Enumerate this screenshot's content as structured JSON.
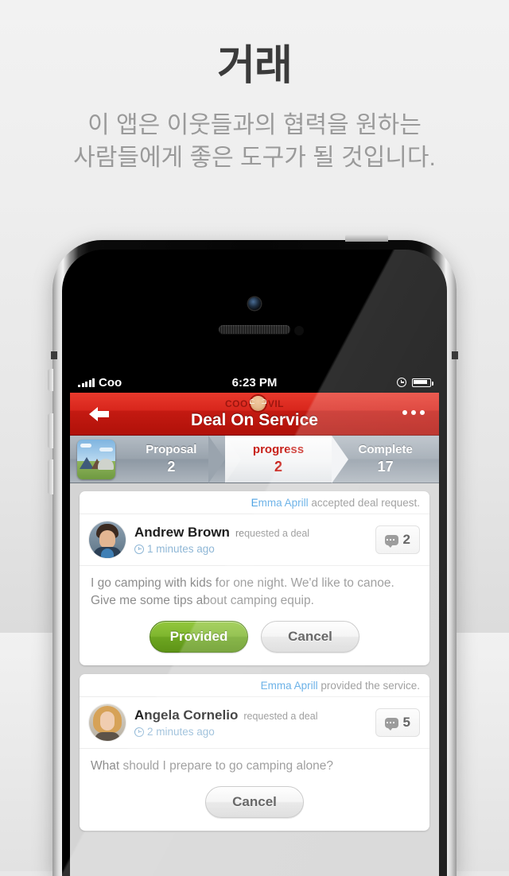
{
  "page": {
    "headline": "거래",
    "subtitle_line1": "이 앱은 이웃들과의 협력을 원하는",
    "subtitle_line2": "사람들에게 좋은 도구가 될 것입니다."
  },
  "status_bar": {
    "carrier": "Coo",
    "time": "6:23 PM",
    "signal_icon": "signal-bars-icon",
    "alarm_icon": "alarm-clock-icon",
    "battery_icon": "battery-icon"
  },
  "nav_bar": {
    "back_icon": "back-arrow-icon",
    "more_icon": "more-options-icon",
    "logo_left": "COO",
    "logo_right": "VIL",
    "logo_badge_icon": "bull-head-icon",
    "title": "Deal On Service",
    "accent_color": "#d8261c"
  },
  "steps": {
    "thumbnail_icon": "camping-photo-thumbnail",
    "items": [
      {
        "label": "Proposal",
        "count": "2",
        "active": false
      },
      {
        "label": "progress",
        "count": "2",
        "active": true
      },
      {
        "label": "Complete",
        "count": "17",
        "active": false
      }
    ],
    "active_color": "#c8221b"
  },
  "cards": [
    {
      "note_user": "Emma Aprill",
      "note_text": " accepted deal request.",
      "avatar_icon": "avatar-andrew-brown",
      "user_name": "Andrew Brown",
      "user_action": "requested a deal",
      "clock_icon": "clock-icon",
      "timestamp": "1 minutes ago",
      "comment_icon": "comment-bubble-icon",
      "comment_count": "2",
      "message": "I go camping with kids for one night. We'd like to canoe. Give me some tips about camping equip.",
      "buttons": [
        {
          "label": "Provided",
          "style": "green"
        },
        {
          "label": "Cancel",
          "style": "gray"
        }
      ]
    },
    {
      "note_user": "Emma Aprill",
      "note_text": " provided the service.",
      "avatar_icon": "avatar-angela-cornelio",
      "user_name": "Angela Cornelio",
      "user_action": "requested a deal",
      "clock_icon": "clock-icon",
      "timestamp": "2 minutes ago",
      "comment_icon": "comment-bubble-icon",
      "comment_count": "5",
      "message": "What should I prepare to go camping alone?",
      "buttons": [
        {
          "label": "Cancel",
          "style": "gray"
        }
      ]
    }
  ]
}
